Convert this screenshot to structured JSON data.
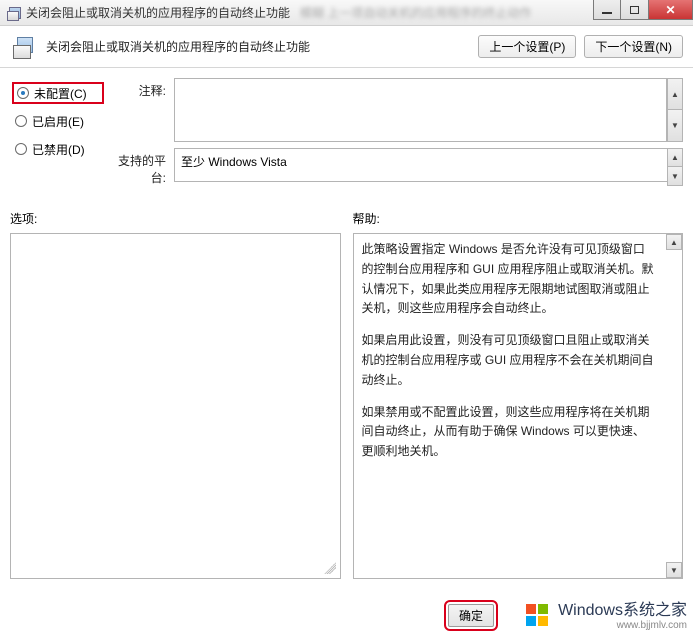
{
  "titlebar": {
    "title": "关闭会阻止或取消关机的应用程序的自动终止功能"
  },
  "header": {
    "title": "关闭会阻止或取消关机的应用程序的自动终止功能",
    "prev_label": "上一个设置(P)",
    "next_label": "下一个设置(N)"
  },
  "radios": {
    "not_configured": {
      "label": "未配置(C)",
      "selected": true
    },
    "enabled": {
      "label": "已启用(E)",
      "selected": false
    },
    "disabled": {
      "label": "已禁用(D)",
      "selected": false
    }
  },
  "fields": {
    "comment_label": "注释:",
    "comment_value": "",
    "platform_label": "支持的平台:",
    "platform_value": "至少 Windows Vista"
  },
  "lower": {
    "options_label": "选项:",
    "help_label": "帮助:",
    "help_paragraphs": {
      "p1": "此策略设置指定 Windows 是否允许没有可见顶级窗口的控制台应用程序和 GUI 应用程序阻止或取消关机。默认情况下，如果此类应用程序无限期地试图取消或阻止关机，则这些应用程序会自动终止。",
      "p2": "如果启用此设置，则没有可见顶级窗口且阻止或取消关机的控制台应用程序或 GUI 应用程序不会在关机期间自动终止。",
      "p3": "如果禁用或不配置此设置，则这些应用程序将在关机期间自动终止，从而有助于确保 Windows 可以更快速、更顺利地关机。"
    }
  },
  "buttons": {
    "ok_label": "确定"
  },
  "watermark": {
    "line1": "Windows系统之家",
    "line2": "www.bjjmlv.com"
  }
}
